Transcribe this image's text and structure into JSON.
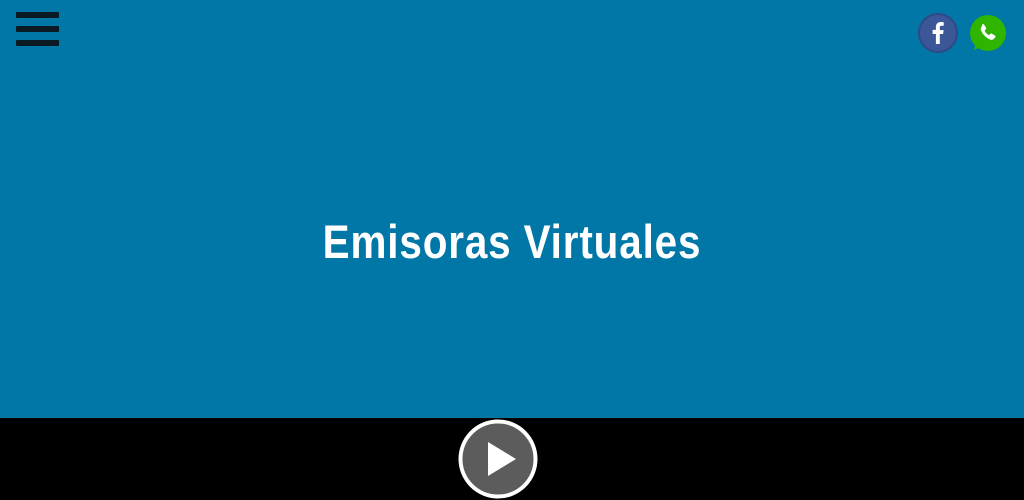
{
  "header": {
    "menu_icon": "hamburger-menu-icon",
    "social": [
      {
        "name": "facebook",
        "icon": "facebook-icon",
        "color": "#3b5798"
      },
      {
        "name": "whatsapp",
        "icon": "whatsapp-icon",
        "color": "#2fb400"
      }
    ]
  },
  "main": {
    "title": "Emisoras Virtuales",
    "background_color": "#0077a6"
  },
  "player": {
    "play_icon": "play-icon",
    "bar_color": "#000000"
  }
}
